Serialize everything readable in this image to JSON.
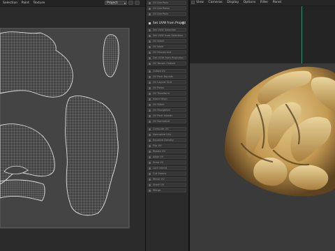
{
  "uv_editor": {
    "menu": [
      "Selection",
      "Paint",
      "Texture"
    ],
    "projection_mode": "Project"
  },
  "ops_panel": {
    "items": [
      {
        "label": "UV Lite Pack",
        "active": false
      },
      {
        "label": "UV Lite Relax",
        "active": false
      },
      {
        "label": "UV Lite Pack",
        "active": false
      },
      {
        "label": "Set UVW from Projection",
        "active": true
      },
      {
        "label": "Set UVW Selection",
        "active": false
      },
      {
        "label": "Set UVW from Selection",
        "active": false
      },
      {
        "label": "UV Stitch",
        "active": false
      },
      {
        "label": "UV Weld",
        "active": false
      },
      {
        "label": "UV Disconnect",
        "active": false
      },
      {
        "label": "Get UVW from Projection",
        "active": false
      },
      {
        "label": "UV Terrain Flatten",
        "active": false
      },
      {
        "label": "Unfold UV",
        "active": false
      },
      {
        "label": "UV Pack Bounds",
        "active": false
      },
      {
        "label": "UV Layout Grid",
        "active": false
      },
      {
        "label": "UV Relax",
        "active": false
      },
      {
        "label": "UV Transform",
        "active": false
      },
      {
        "label": "Island Align",
        "active": false
      },
      {
        "label": "UV Stitch",
        "active": false
      },
      {
        "label": "UV Straighten",
        "active": false
      },
      {
        "label": "UV Pack Islands",
        "active": false
      },
      {
        "label": "UV Normalize",
        "active": false
      },
      {
        "label": "Compute UV",
        "active": false
      },
      {
        "label": "Normalize UVs",
        "active": false
      },
      {
        "label": "Equalize Density",
        "active": false
      },
      {
        "label": "Flip UV",
        "active": false
      },
      {
        "label": "Rotate UV",
        "active": false
      },
      {
        "label": "Align UV",
        "active": false
      },
      {
        "label": "Snap UV",
        "active": false
      },
      {
        "label": "Lock Island",
        "active": false
      },
      {
        "label": "Cut Seams",
        "active": false
      },
      {
        "label": "Mirror UV",
        "active": false
      },
      {
        "label": "Stack UV",
        "active": false
      },
      {
        "label": "Merge",
        "active": false
      }
    ]
  },
  "viewport": {
    "menu": [
      "View",
      "Cameras",
      "Display",
      "Options",
      "Filter",
      "Panel"
    ]
  },
  "colors": {
    "uv_background": "#444444",
    "uv_wire": "#d8d8d8",
    "walnut_light": "#d9bc7a",
    "walnut_dark": "#6b4e25",
    "axis_green": "#2f8f6f"
  }
}
